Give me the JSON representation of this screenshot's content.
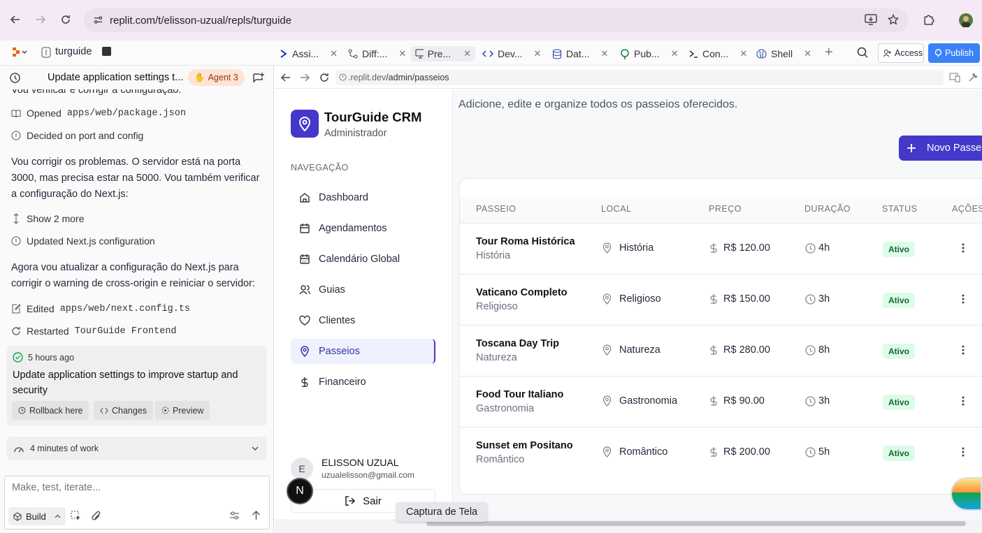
{
  "browser": {
    "url": "replit.com/t/elisson-uzual/repls/turguide"
  },
  "replit": {
    "project": "turguide",
    "tabs": [
      "Assi...",
      "Diff:...",
      "Pre...",
      "Dev...",
      "Dat...",
      "Pub...",
      "Con...",
      "Shell"
    ],
    "access": "Access",
    "publish": "Publish"
  },
  "agent": {
    "title": "Update application settings t...",
    "badge": "Agent 3",
    "cut_line": "Vou verificar e corrigir a configuração:",
    "opened_label": "Opened",
    "opened_file": "apps/web/package.json",
    "decided": "Decided on port and config",
    "para1": "Vou corrigir os problemas. O servidor está na porta 3000, mas precisa estar na 5000. Vou também verificar a configuração do Next.js:",
    "show_more": "Show 2 more",
    "updated": "Updated Next.js configuration",
    "para2": "Agora vou atualizar a configuração do Next.js para corrigir o warning de cross-origin e reiniciar o servidor:",
    "edited_label": "Edited",
    "edited_file": "apps/web/next.config.ts",
    "restarted_label": "Restarted",
    "restarted_name": "TourGuide Frontend",
    "checkpoint_time": "5 hours ago",
    "checkpoint_text": "Update application settings to improve startup and security",
    "rollback": "Rollback here",
    "changes": "Changes",
    "preview": "Preview",
    "work": "4 minutes of work",
    "input_placeholder": "Make, test, iterate...",
    "build": "Build"
  },
  "preview": {
    "url_host": ".replit.dev",
    "url_path": "/admin/passeios"
  },
  "app": {
    "brand": "TourGuide CRM",
    "role": "Administrador",
    "nav_heading": "NAVEGAÇÃO",
    "nav": [
      "Dashboard",
      "Agendamentos",
      "Calendário Global",
      "Guias",
      "Clientes",
      "Passeios",
      "Financeiro"
    ],
    "user_initial": "E",
    "user_name": "ELISSON UZUAL",
    "user_email": "uzualelisson@gmail.com",
    "logout": "Sair",
    "subtitle": "Adicione, edite e organize todos os passeios oferecidos.",
    "new_button": "Novo Passe",
    "headers": [
      "PASSEIO",
      "LOCAL",
      "PREÇO",
      "DURAÇÃO",
      "STATUS",
      "AÇÕES"
    ],
    "rows": [
      {
        "name": "Tour Roma Histórica",
        "category": "História",
        "local": "História",
        "price": "R$ 120.00",
        "duration": "4h",
        "status": "Ativo"
      },
      {
        "name": "Vaticano Completo",
        "category": "Religioso",
        "local": "Religioso",
        "price": "R$ 150.00",
        "duration": "3h",
        "status": "Ativo"
      },
      {
        "name": "Toscana Day Trip",
        "category": "Natureza",
        "local": "Natureza",
        "price": "R$ 280.00",
        "duration": "8h",
        "status": "Ativo"
      },
      {
        "name": "Food Tour Italiano",
        "category": "Gastronomia",
        "local": "Gastronomia",
        "price": "R$ 90.00",
        "duration": "3h",
        "status": "Ativo"
      },
      {
        "name": "Sunset em Positano",
        "category": "Romântico",
        "local": "Romântico",
        "price": "R$ 200.00",
        "duration": "5h",
        "status": "Ativo"
      }
    ],
    "tooltip": "Captura de Tela",
    "next_badge": "N"
  }
}
